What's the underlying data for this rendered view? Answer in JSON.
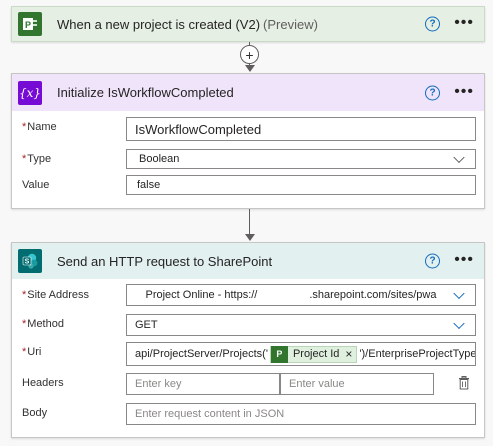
{
  "trigger": {
    "title": "When a new project is created (V2)",
    "subtitle": "(Preview)",
    "icon": "project-icon",
    "color": "#31752f"
  },
  "init_variable": {
    "title": "Initialize IsWorkflowCompleted",
    "icon": "variable-icon",
    "color": "#770bd6",
    "fields": {
      "name_label": "Name",
      "name_value": "IsWorkflowCompleted",
      "type_label": "Type",
      "type_value": "Boolean",
      "value_label": "Value",
      "value_value": "false"
    }
  },
  "http_request": {
    "title": "Send an HTTP request to SharePoint",
    "icon": "sharepoint-icon",
    "color": "#036c70",
    "fields": {
      "site_label": "Site Address",
      "site_value": "Project Online - https://                 .sharepoint.com/sites/pwa",
      "method_label": "Method",
      "method_value": "GET",
      "uri_label": "Uri",
      "uri_prefix": "api/ProjectServer/Projects('",
      "uri_token": "Project Id",
      "uri_suffix": "')/EnterpriseProjectType",
      "headers_label": "Headers",
      "header_key_placeholder": "Enter key",
      "header_value_placeholder": "Enter value",
      "body_label": "Body",
      "body_placeholder": "Enter request content in JSON"
    }
  },
  "common": {
    "help": "?",
    "more": "•••",
    "required_mark": "*",
    "token_remove": "×",
    "add_step": "+"
  }
}
